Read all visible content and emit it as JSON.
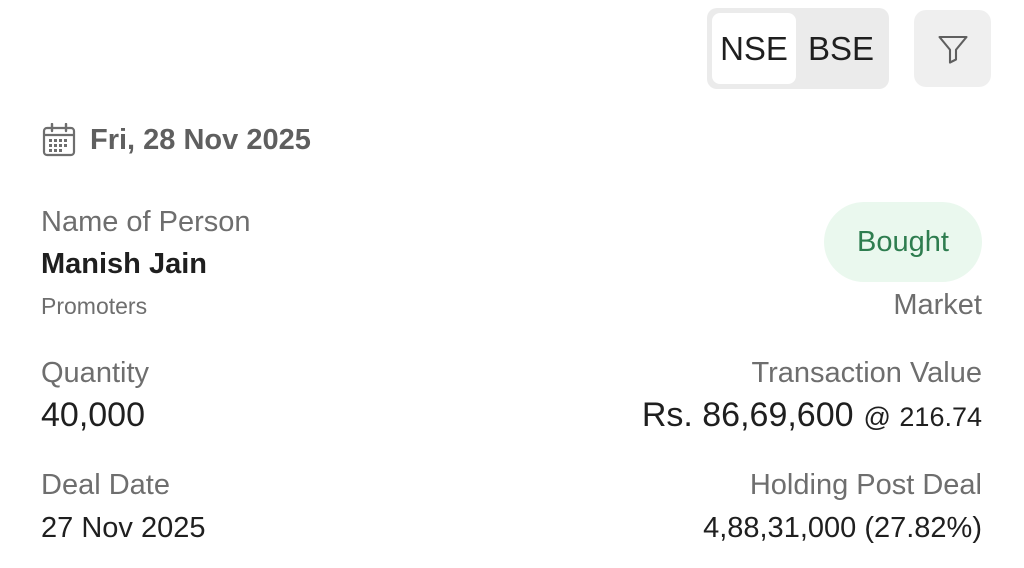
{
  "exchange_toggle": {
    "options": [
      "NSE",
      "BSE"
    ],
    "selected": "NSE"
  },
  "filter": {
    "icon": "filter-funnel-icon"
  },
  "header": {
    "date": "Fri, 28 Nov 2025",
    "icon": "calendar-icon"
  },
  "deal": {
    "person_label": "Name of Person",
    "person_name": "Manish Jain",
    "person_category": "Promoters",
    "action": "Bought",
    "action_color": "#2e7d4f",
    "action_bg": "#eaf8ee",
    "mode": "Market",
    "quantity_label": "Quantity",
    "quantity": "40,000",
    "transaction_value_label": "Transaction Value",
    "transaction_value": "Rs. 86,69,600",
    "price_prefix": "@",
    "price": "216.74",
    "deal_date_label": "Deal Date",
    "deal_date": "27 Nov 2025",
    "holding_label": "Holding Post Deal",
    "holding": "4,88,31,000 (27.82%)"
  }
}
